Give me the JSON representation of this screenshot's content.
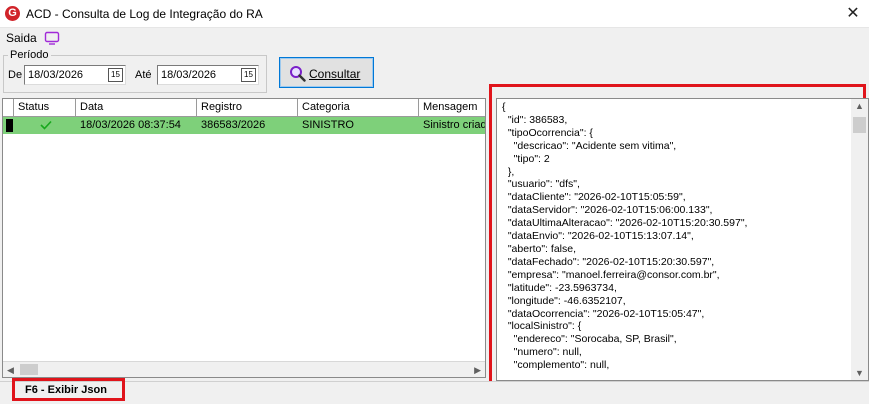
{
  "window": {
    "title": "ACD - Consulta de Log de Integração do RA",
    "app_icon": "G",
    "close": "✕"
  },
  "menu": {
    "saida": "Saida",
    "monitor_icon": "monitor-icon"
  },
  "filters": {
    "group_label": "Período",
    "from_label": "De",
    "from_value": "18/03/2026",
    "to_label": "Até",
    "to_value": "18/03/2026",
    "calendar_icon": "15",
    "consultar_label": "Consultar"
  },
  "grid": {
    "columns": [
      "Status",
      "Data",
      "Registro",
      "Categoria",
      "Mensagem"
    ],
    "rows": [
      {
        "status": "✓",
        "data": "18/03/2026 08:37:54",
        "registro": "386583/2026",
        "categoria": "SINISTRO",
        "mensagem": "Sinistro criado"
      }
    ],
    "row_highlight_color": "#7ed07a"
  },
  "json_panel": {
    "lines": [
      "{",
      "  \"id\": 386583,",
      "  \"tipoOcorrencia\": {",
      "    \"descricao\": \"Acidente sem vitima\",",
      "    \"tipo\": 2",
      "  },",
      "  \"usuario\": \"dfs\",",
      "  \"dataCliente\": \"2026-02-10T15:05:59\",",
      "  \"dataServidor\": \"2026-02-10T15:06:00.133\",",
      "  \"dataUltimaAlteracao\": \"2026-02-10T15:20:30.597\",",
      "  \"dataEnvio\": \"2026-02-10T15:13:07.14\",",
      "  \"aberto\": false,",
      "  \"dataFechado\": \"2026-02-10T15:20:30.597\",",
      "  \"empresa\": \"manoel.ferreira@consor.com.br\",",
      "  \"latitude\": -23.5963734,",
      "  \"longitude\": -46.6352107,",
      "  \"dataOcorrencia\": \"2026-02-10T15:05:47\",",
      "  \"localSinistro\": {",
      "    \"endereco\": \"Sorocaba, SP, Brasil\",",
      "    \"numero\": null,",
      "    \"complemento\": null,"
    ]
  },
  "status_bar": {
    "shortcut": "F6 - Exibir Json"
  },
  "colors": {
    "highlight_border": "#e0141b",
    "accent": "#0078d7"
  }
}
